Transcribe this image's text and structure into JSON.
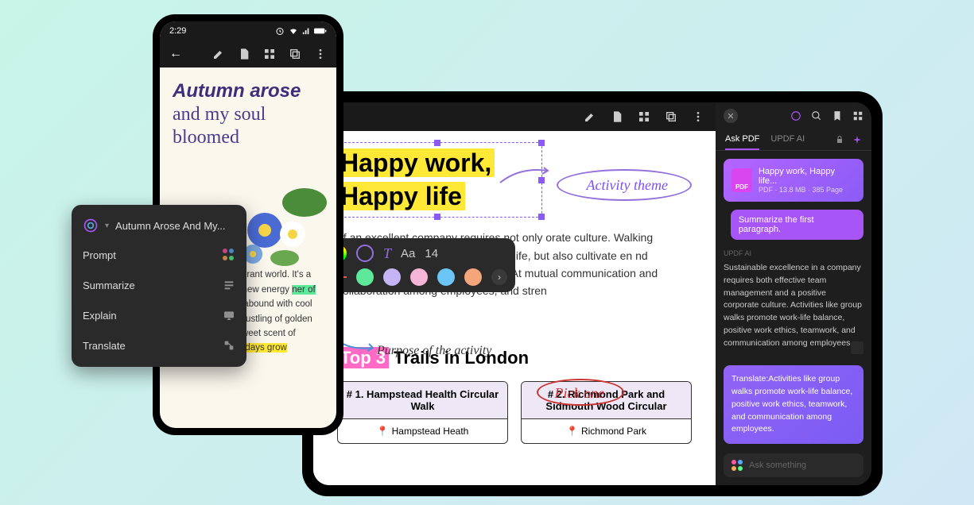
{
  "phone": {
    "status_time": "2:29",
    "title_bold": "Autumn arose",
    "title_light": "and my soul bloomed",
    "body_p1_prefix": "s of autumn as vibrant",
    "body_p2": "world. It's a season of",
    "body_p3": "brings new energy",
    "body_hl_green": "ner of nature.",
    "body_p4": " The days abound with cool breezes, the soft rustling of golden leaves, and the sweet scent of freshness. ",
    "body_hl_yellow": "As the days grow"
  },
  "popup": {
    "title": "Autumn Arose And My...",
    "items": [
      {
        "label": "Prompt"
      },
      {
        "label": "Summarize"
      },
      {
        "label": "Explain"
      },
      {
        "label": "Translate"
      }
    ]
  },
  "tablet": {
    "headline_l1": "Happy work,",
    "headline_l2": "Happy life",
    "anno_theme": "Activity theme",
    "toolbar": {
      "font_label": "Aa",
      "font_size": "14",
      "colors": [
        "#5de89a",
        "#c6b5f5",
        "#f5b5d6",
        "#6bc5f5",
        "#f5a57a"
      ]
    },
    "body_text": "of an excellent company requires not only orate culture. Walking activities can not e work and happy life, but also cultivate en nd enterprising company atmosphere. At mutual communication and collaboration among employees, and stren",
    "anno_purpose": "Purpose of the activity",
    "subhead_hl": "Top 3",
    "subhead_rest": " Trails in London",
    "anno_pick": "Pick one",
    "trails": [
      {
        "title": "# 1. Hampstead Health Circular Walk",
        "location": "Hampstead Heath"
      },
      {
        "title": "# 2. Richmond Park and Sidmouth Wood Circular",
        "location": "Richmond Park"
      }
    ]
  },
  "ai": {
    "tabs": {
      "ask": "Ask PDF",
      "updf": "UPDF AI"
    },
    "file": {
      "title": "Happy work, Happy life...",
      "meta": "PDF · 13.8 MB · 385 Page",
      "badge": "PDF"
    },
    "user_msg": "Summarize the first paragraph.",
    "section_label": "UPDF AI",
    "response": "Sustainable excellence in a company requires both effective team management and a positive corporate culture. Activities like group walks promote work-life balance, positive work ethics, teamwork, and communication among employees.",
    "translate": "Translate:Activities like group walks promote work-life balance, positive work ethics, teamwork, and communication among employees.",
    "input_placeholder": "Ask something"
  }
}
